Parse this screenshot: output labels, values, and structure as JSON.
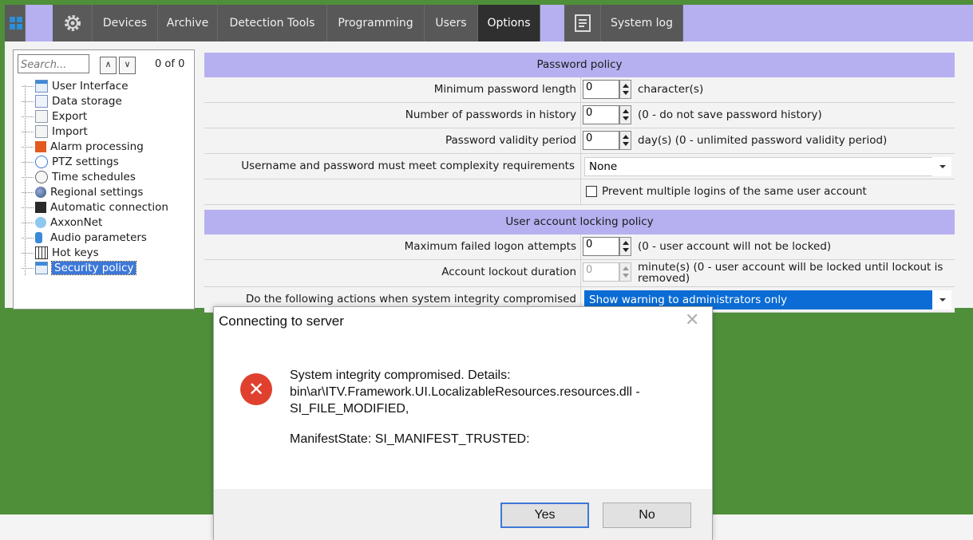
{
  "topbar": {
    "tabs": [
      {
        "label": "Devices"
      },
      {
        "label": "Archive"
      },
      {
        "label": "Detection Tools"
      },
      {
        "label": "Programming"
      },
      {
        "label": "Users"
      },
      {
        "label": "Options"
      },
      {
        "label": "System log"
      }
    ],
    "active_tab": "Options"
  },
  "leftpanel": {
    "search_placeholder": "Search...",
    "count": "0 of 0",
    "items": [
      {
        "label": "User Interface"
      },
      {
        "label": "Data storage"
      },
      {
        "label": "Export"
      },
      {
        "label": "Import"
      },
      {
        "label": "Alarm processing"
      },
      {
        "label": "PTZ settings"
      },
      {
        "label": "Time schedules"
      },
      {
        "label": "Regional settings"
      },
      {
        "label": "Automatic connection"
      },
      {
        "label": "AxxonNet"
      },
      {
        "label": "Audio parameters"
      },
      {
        "label": "Hot keys"
      },
      {
        "label": "Security policy"
      }
    ],
    "selected": "Security policy"
  },
  "password_policy": {
    "header": "Password policy",
    "min_length_label": "Minimum password length",
    "min_length_value": "0",
    "min_length_hint": "character(s)",
    "history_label": "Number of passwords in history",
    "history_value": "0",
    "history_hint": "(0 - do not save password history)",
    "validity_label": "Password validity period",
    "validity_value": "0",
    "validity_hint": "day(s) (0 - unlimited password validity period)",
    "complexity_label": "Username and password must meet complexity requirements",
    "complexity_value": "None",
    "multiple_logins_label": "Prevent multiple logins of the same user account"
  },
  "locking_policy": {
    "header": "User account locking policy",
    "max_attempts_label": "Maximum failed logon attempts",
    "max_attempts_value": "0",
    "max_attempts_hint": "(0 - user account will not be locked)",
    "duration_label": "Account lockout duration",
    "duration_value": "0",
    "duration_hint_line1": "minute(s) (0 - user account will be locked until lockout is",
    "duration_hint_line2": "removed)",
    "integrity_label": "Do the following actions when system integrity compromised",
    "integrity_value": "Show warning to administrators only"
  },
  "dialog": {
    "title": "Connecting to server",
    "close_glyph": "✕",
    "message_line1": "System integrity compromised. Details:",
    "message_line2": "bin\\ar\\ITV.Framework.UI.LocalizableResources.resources.dll -",
    "message_line3": "SI_FILE_MODIFIED,",
    "message_line4": "ManifestState: SI_MANIFEST_TRUSTED:",
    "yes_label": "Yes",
    "no_label": "No"
  },
  "colors": {
    "background_green": "#4f8f3a",
    "topbar_lavender": "#b6b0f0",
    "tab_dark": "#585858",
    "selection_blue": "#0a6cd4",
    "error_red": "#e0412e"
  }
}
